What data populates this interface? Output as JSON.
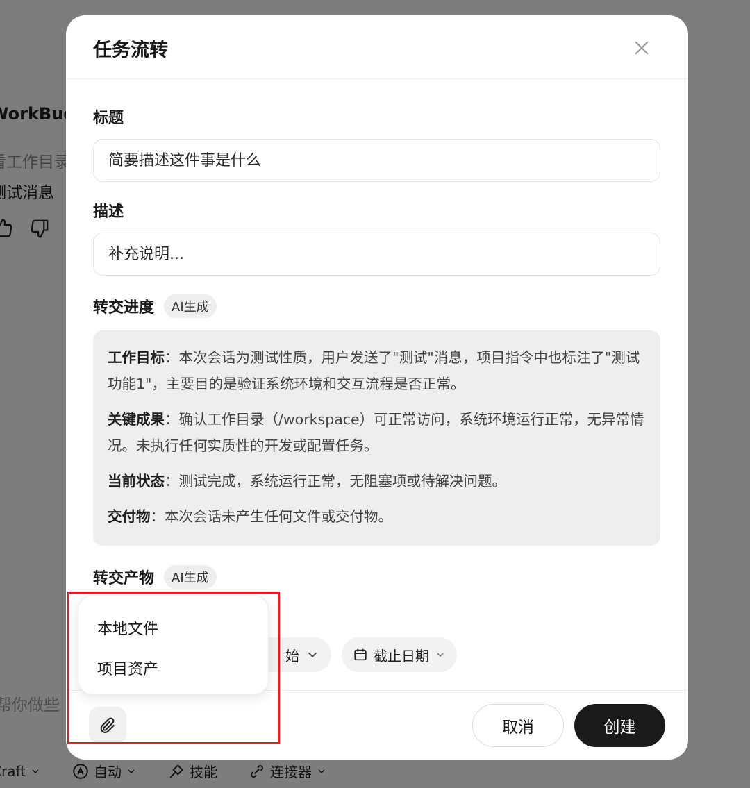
{
  "background": {
    "app_title": "WorkBudd",
    "line1": "看工作目录",
    "line2": "测试消息",
    "input_placeholder": "帮你做些",
    "toolbar": {
      "craft": "Craft",
      "auto": "自动",
      "skills": "技能",
      "connectors": "连接器"
    }
  },
  "dialog": {
    "title": "任务流转",
    "title_field": {
      "label": "标题",
      "placeholder": "简要描述这件事是什么"
    },
    "desc_field": {
      "label": "描述",
      "placeholder": "补充说明..."
    },
    "progress": {
      "label": "转交进度",
      "badge": "AI生成",
      "items": [
        {
          "key": "工作目标",
          "sep": "：",
          "text": "本次会话为测试性质，用户发送了\"测试\"消息，项目指令中也标注了\"测试功能1\"，主要目的是验证系统环境和交互流程是否正常。"
        },
        {
          "key": "关键成果",
          "sep": "：",
          "text": "确认工作目录（/workspace）可正常访问，系统环境运行正常，无异常情况。未执行任何实质性的开发或配置任务。"
        },
        {
          "key": "当前状态",
          "sep": "：",
          "text": "测试完成，系统运行正常，无阻塞项或待解决问题。"
        },
        {
          "key": "交付物",
          "sep": "：",
          "text": "本次会话未产生任何文件或交付物。"
        }
      ]
    },
    "artifacts": {
      "label": "转交产物",
      "badge": "AI生成"
    },
    "start_pill_fragment": "始",
    "due_date": "截止日期",
    "popup_menu": {
      "items": [
        "本地文件",
        "项目资产"
      ]
    },
    "buttons": {
      "cancel": "取消",
      "create": "创建"
    }
  }
}
